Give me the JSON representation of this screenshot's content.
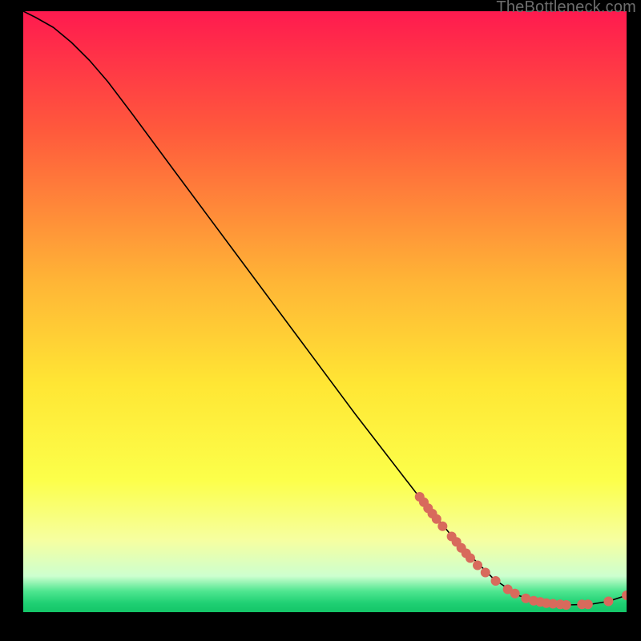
{
  "watermark": "TheBottleneck.com",
  "chart_data": {
    "type": "line",
    "title": "",
    "xlabel": "",
    "ylabel": "",
    "xlim": [
      0,
      100
    ],
    "ylim": [
      0,
      100
    ],
    "grid": false,
    "legend": false,
    "gradient_stops": [
      {
        "offset": 0.0,
        "color": "#ff1a4f"
      },
      {
        "offset": 0.2,
        "color": "#ff5a3c"
      },
      {
        "offset": 0.45,
        "color": "#ffb536"
      },
      {
        "offset": 0.62,
        "color": "#ffe634"
      },
      {
        "offset": 0.78,
        "color": "#fcff4a"
      },
      {
        "offset": 0.88,
        "color": "#f6ffa0"
      },
      {
        "offset": 0.94,
        "color": "#cdffcf"
      },
      {
        "offset": 0.965,
        "color": "#4fe690"
      },
      {
        "offset": 0.985,
        "color": "#1fd073"
      },
      {
        "offset": 1.0,
        "color": "#14c568"
      }
    ],
    "curve": [
      {
        "x": 0.0,
        "y": 100.0
      },
      {
        "x": 2.0,
        "y": 99.0
      },
      {
        "x": 5.0,
        "y": 97.3
      },
      {
        "x": 8.0,
        "y": 94.8
      },
      {
        "x": 11.0,
        "y": 91.8
      },
      {
        "x": 14.0,
        "y": 88.3
      },
      {
        "x": 18.0,
        "y": 83.0
      },
      {
        "x": 25.0,
        "y": 73.5
      },
      {
        "x": 35.0,
        "y": 60.0
      },
      {
        "x": 45.0,
        "y": 46.5
      },
      {
        "x": 55.0,
        "y": 33.0
      },
      {
        "x": 65.0,
        "y": 20.0
      },
      {
        "x": 72.0,
        "y": 11.5
      },
      {
        "x": 78.0,
        "y": 5.5
      },
      {
        "x": 82.0,
        "y": 2.8
      },
      {
        "x": 86.0,
        "y": 1.5
      },
      {
        "x": 90.0,
        "y": 1.2
      },
      {
        "x": 94.0,
        "y": 1.3
      },
      {
        "x": 97.0,
        "y": 1.8
      },
      {
        "x": 100.0,
        "y": 2.8
      }
    ],
    "series": [
      {
        "name": "points",
        "type": "scatter",
        "color": "#d86a5c",
        "points": [
          {
            "x": 65.7,
            "y": 19.2
          },
          {
            "x": 66.4,
            "y": 18.3
          },
          {
            "x": 67.1,
            "y": 17.3
          },
          {
            "x": 67.8,
            "y": 16.4
          },
          {
            "x": 68.5,
            "y": 15.5
          },
          {
            "x": 69.5,
            "y": 14.3
          },
          {
            "x": 71.0,
            "y": 12.6
          },
          {
            "x": 71.8,
            "y": 11.7
          },
          {
            "x": 72.6,
            "y": 10.7
          },
          {
            "x": 73.4,
            "y": 9.8
          },
          {
            "x": 74.1,
            "y": 9.0
          },
          {
            "x": 75.3,
            "y": 7.8
          },
          {
            "x": 76.6,
            "y": 6.6
          },
          {
            "x": 78.3,
            "y": 5.2
          },
          {
            "x": 80.3,
            "y": 3.8
          },
          {
            "x": 81.5,
            "y": 3.1
          },
          {
            "x": 83.3,
            "y": 2.3
          },
          {
            "x": 84.6,
            "y": 1.9
          },
          {
            "x": 85.7,
            "y": 1.7
          },
          {
            "x": 86.7,
            "y": 1.5
          },
          {
            "x": 87.8,
            "y": 1.4
          },
          {
            "x": 89.0,
            "y": 1.3
          },
          {
            "x": 90.0,
            "y": 1.2
          },
          {
            "x": 92.6,
            "y": 1.3
          },
          {
            "x": 93.6,
            "y": 1.3
          },
          {
            "x": 97.0,
            "y": 1.8
          },
          {
            "x": 100.0,
            "y": 2.8
          }
        ]
      }
    ]
  }
}
